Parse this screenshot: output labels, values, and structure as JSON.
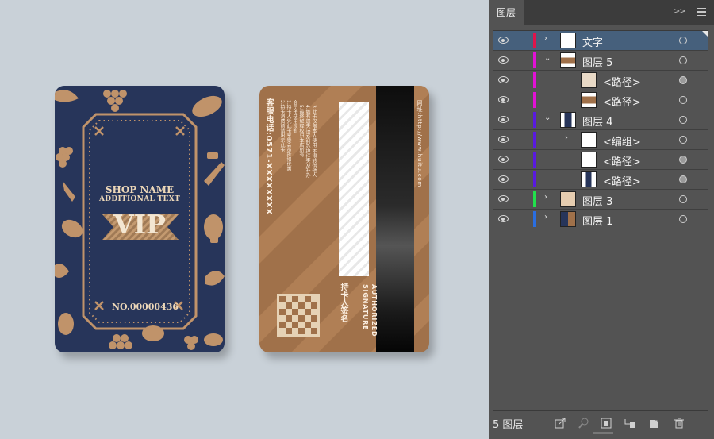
{
  "colors": {
    "canvas_bg": "#c9d1d8",
    "front_card": "#27355a",
    "front_ornament": "#c0936a",
    "front_text": "#ecd7b8",
    "back_card": "#a0714a",
    "back_stripe_light": "#b07f55",
    "panel_bg": "#535353",
    "panel_selected": "#46607c"
  },
  "card_front": {
    "shop_name": "SHOP NAME",
    "additional_text": "ADDITIONAL TEXT",
    "vip": "VIP",
    "number": "NO.00000436"
  },
  "card_back": {
    "hotline": "客服电话:0571-XXXXXXXX",
    "rules_1": "会员卡使用须知\n1.持卡人凭此卡享受会员折扣优惠\n2.持卡消费前请出示此卡",
    "rules_2": "3.此卡仅限本人使用,不得转借他人\n4.如有遗失,请及时办理挂失及补办\n5.最终解释权归本店所有",
    "website": "网址:http://www.huitu.com",
    "authorized_line1": "AUTHORIZED",
    "authorized_line2": "SIGNATURE",
    "holder_sign": "持卡人签名"
  },
  "layers_panel": {
    "tab_label": "图层",
    "layer_count": "5 图层",
    "layers": [
      {
        "name": "文字",
        "color": "#e0144c",
        "expander": "›",
        "selected": true,
        "target_filled": false
      },
      {
        "name": "图层 5",
        "color": "#e212d6",
        "expander": "⌄",
        "selected": false,
        "target_filled": false
      },
      {
        "name": "<路径>",
        "color": "#e212d6",
        "expander": "",
        "selected": false,
        "target_filled": true
      },
      {
        "name": "<路径>",
        "color": "#e212d6",
        "expander": "",
        "selected": false,
        "target_filled": false
      },
      {
        "name": "图层 4",
        "color": "#5a1ae0",
        "expander": "⌄",
        "selected": false,
        "target_filled": false
      },
      {
        "name": "<编组>",
        "color": "#5a1ae0",
        "expander": "›",
        "selected": false,
        "target_filled": false
      },
      {
        "name": "<路径>",
        "color": "#5a1ae0",
        "expander": "",
        "selected": false,
        "target_filled": true
      },
      {
        "name": "<路径>",
        "color": "#5a1ae0",
        "expander": "",
        "selected": false,
        "target_filled": true
      },
      {
        "name": "图层 3",
        "color": "#22e04c",
        "expander": "›",
        "selected": false,
        "target_filled": false
      },
      {
        "name": "图层 1",
        "color": "#2a6ee0",
        "expander": "›",
        "selected": false,
        "target_filled": false
      }
    ],
    "footer_icons": [
      "export-icon",
      "locate-object-icon",
      "make-clipping-mask-icon",
      "new-sublayer-icon",
      "new-layer-icon",
      "trash-icon"
    ]
  }
}
